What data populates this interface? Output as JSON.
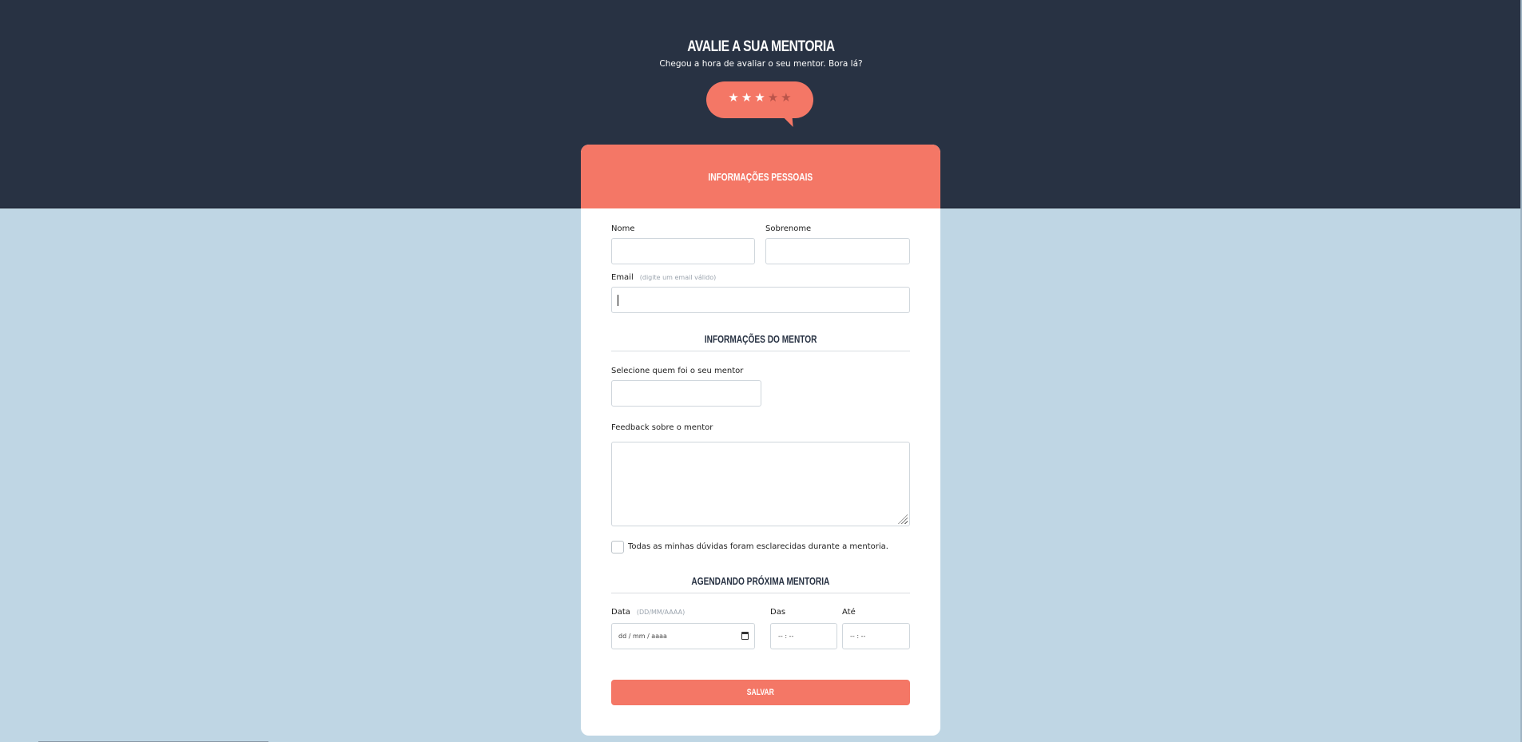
{
  "header": {
    "title": "AVALIE A SUA MENTORIA",
    "subtitle": "Chegou a hora de avaliar o seu mentor. Bora lá?"
  },
  "rating": {
    "value": 3,
    "max": 5,
    "icon": "star-icon",
    "color": "#f47766"
  },
  "colors": {
    "dark": "#283243",
    "accent": "#f47766",
    "background": "#bfd6e4"
  },
  "personal": {
    "title": "INFORMAÇÕES PESSOAIS",
    "first_name_label": "Nome",
    "last_name_label": "Sobrenome",
    "email_label": "Email",
    "email_hint": "(digite um email válido)"
  },
  "mentor": {
    "title": "INFORMAÇÕES DO MENTOR",
    "select_label": "Selecione quem foi o seu mentor",
    "feedback_label": "Feedback sobre o mentor",
    "checkbox_label": "Todas as minhas dúvidas foram esclarecidas durante a mentoria."
  },
  "schedule": {
    "title": "AGENDANDO PRÓXIMA MENTORIA",
    "date_label": "Data",
    "date_hint": "(DD/MM/AAAA)",
    "date_placeholder": "dd / mm / aaaa",
    "from_label": "Das",
    "to_label": "Até",
    "time_placeholder": "-- : --"
  },
  "save_label": "SALVAR"
}
